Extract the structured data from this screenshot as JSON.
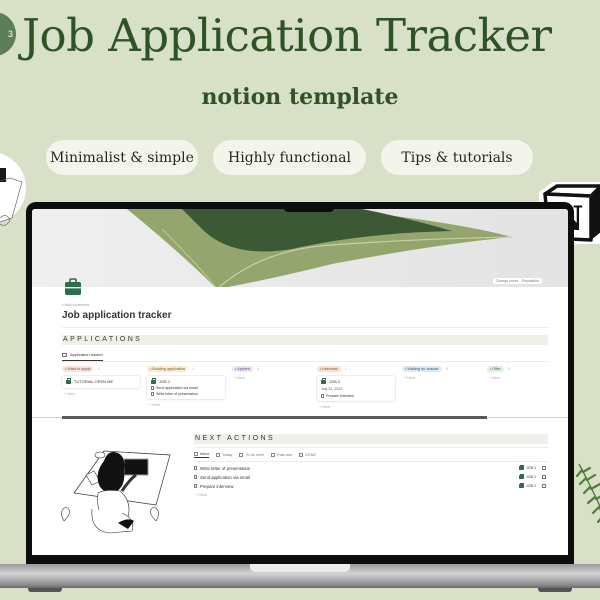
{
  "banner": {
    "title": "Job Application Tracker",
    "subtitle": "notion template",
    "badge_text": "3",
    "features": [
      "Minimalist & simple",
      "Highly functional",
      "Tips & tutorials"
    ],
    "brand_color": "#2f5226",
    "background_color": "#d8e0c8"
  },
  "notion_page": {
    "cover_buttons": [
      "Change cover",
      "Reposition"
    ],
    "page_icon": "briefcase-icon",
    "add_comment": "Add comment",
    "title": "Job application tracker",
    "applications": {
      "heading": "APPLICATIONS",
      "view_tab": "Application tracker",
      "columns": [
        {
          "label": "Want to apply",
          "count": "1",
          "bg": "#fbe4dc",
          "fg": "#8a4a32",
          "cards": [
            {
              "title": "TUTORIAL OPEN ME"
            }
          ],
          "new": "+ New"
        },
        {
          "label": "Building application",
          "count": "1",
          "bg": "#fbeccd",
          "fg": "#7a5a1c",
          "cards": [
            {
              "title": "JOB 1",
              "items": [
                "Send application via email",
                "Write letter of presentation"
              ]
            }
          ],
          "new": "+ New"
        },
        {
          "label": "Applied",
          "count": "0",
          "bg": "#ece3f5",
          "fg": "#6a4a8a",
          "cards": [],
          "new": "+ New"
        },
        {
          "label": "Interview",
          "count": "1",
          "bg": "#fbe1cf",
          "fg": "#8a4a22",
          "cards": [
            {
              "title": "JOB 2",
              "date": "July 21, 2023",
              "items": [
                "Prepare interview"
              ]
            }
          ],
          "new": "+ New"
        },
        {
          "label": "Waiting for answer",
          "count": "0",
          "bg": "#dde9f5",
          "fg": "#2e5a86",
          "cards": [],
          "new": "+ New"
        },
        {
          "label": "Offer",
          "count": "0",
          "bg": "#e1efdf",
          "fg": "#3a6a3a",
          "cards": [],
          "new": "+ New"
        }
      ]
    },
    "next_actions": {
      "heading": "NEXT ACTIONS",
      "tabs": [
        "Inbox",
        "Today",
        "To do next!",
        "Past due",
        "DONE"
      ],
      "rows": [
        {
          "task": "Write letter of presentation",
          "job": "JOB 1"
        },
        {
          "task": "Send application via email",
          "job": "JOB 1"
        },
        {
          "task": "Prepare interview",
          "job": "JOB 2"
        }
      ],
      "new": "+ New"
    }
  },
  "logo": {
    "letter": "N"
  }
}
